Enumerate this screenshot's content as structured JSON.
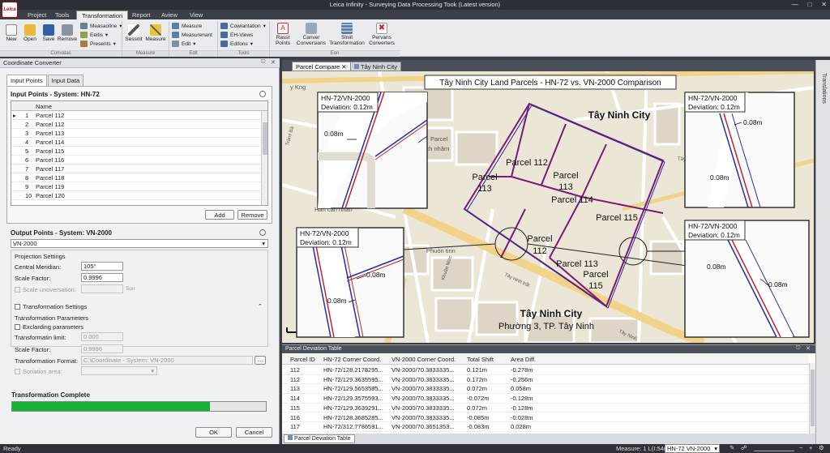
{
  "app": {
    "title": "Leica Infinity - Surveying Data Processing Took (Latest version)",
    "logo": "Leica"
  },
  "menu": [
    "Project",
    "Tools",
    "Transformation",
    "Report",
    "Aview",
    "View"
  ],
  "ribbon": {
    "buttons": [
      "New",
      "Open",
      "Save",
      "Remove",
      "Sessnit",
      "Measure",
      "Rasst\nPoints",
      "Canver\nConversions",
      "Slniit\nTransformation",
      "Pervans\nConverters"
    ],
    "small": [
      "Measaoline",
      "Eeitis",
      "Presents",
      "Measure",
      "Measurenant",
      "Edit",
      "Cowiantation",
      "EH-Views",
      "Edifons"
    ],
    "groups": [
      "Convatas",
      "Measure",
      "Edit",
      "Tools",
      "Eon"
    ]
  },
  "left": {
    "panel_title": "Coordinate Converter",
    "tabs": [
      "Input Points",
      "Input Data"
    ],
    "input_title": "Input Points - System: HN-72",
    "col_name": "Name",
    "rows": [
      {
        "n": "1",
        "name": "Parcel 112"
      },
      {
        "n": "2",
        "name": "Parcel 112"
      },
      {
        "n": "3",
        "name": "Parcel 113"
      },
      {
        "n": "4",
        "name": "Parcel 114"
      },
      {
        "n": "5",
        "name": "Parcel 115"
      },
      {
        "n": "6",
        "name": "Parcel 116"
      },
      {
        "n": "7",
        "name": "Parcel 117"
      },
      {
        "n": "8",
        "name": "Parcel 118"
      },
      {
        "n": "9",
        "name": "Parcel 119"
      },
      {
        "n": "10",
        "name": "Parcel 120"
      }
    ],
    "add": "Add",
    "remove": "Remove",
    "output_title": "Output Points - System: VN-2000",
    "output_system": "VN-2000",
    "proj_settings": "Projection Settings",
    "cm_label": "Central Meridian:",
    "cm_value": "105°",
    "sf_label": "Scale Factor:",
    "sf_value": "0.9996",
    "su_label": "Scale unoversation:",
    "su_value": "",
    "su_unit": "Son",
    "trans_settings": "Transformation Settings",
    "trans_params": "Transformation Parameters",
    "excl_label": "Exclarding parameters",
    "tlimit_label": "Transformatin limit:",
    "tlimit_value": "0.000",
    "sf2_label": "Scale Factor:",
    "sf2_value": "0.9996",
    "tformat_label": "Transformation Format:",
    "tformat_value": "C:\\Coordinate - System: VN-2000",
    "sor_label": "Soriation area:",
    "complete": "Transformation Complete",
    "progress": 0.78,
    "ok": "OK",
    "cancel": "Cancel"
  },
  "doc_tabs": [
    "Parcel Compare",
    "Tây Ninh City"
  ],
  "map": {
    "title": "Tây Ninh City Land Parcels - HN-72 vs. VN-2000 Comparison",
    "city_label": "Tây Ninh City",
    "bottom_city": "Tây Ninh City",
    "ward": "Phường 3, TP. Tây Ninh",
    "parcels": [
      {
        "l1": "Parcel 112",
        "l2": ""
      },
      {
        "l1": "Parcel",
        "l2": "113"
      },
      {
        "l1": "Parcel",
        "l2": "113"
      },
      {
        "l1": "Parcel 114",
        "l2": ""
      },
      {
        "l1": "Parcel 115",
        "l2": ""
      },
      {
        "l1": "Parcel",
        "l2": "112"
      },
      {
        "l1": "Parcel 113",
        "l2": ""
      },
      {
        "l1": "Parcel",
        "l2": "115"
      }
    ],
    "streets": [
      "y Kng",
      "Parcel",
      "rch nhâm",
      "Hàn cán nhàn",
      "Phuòn tirin",
      "Tây ninh trất",
      "Tây Ninh",
      "Trảml Bà",
      "Khuân Mức",
      "Tây"
    ],
    "inset_header": "HN-72/VN-2000",
    "inset_dev": "Deviation: 0.12m",
    "inset_val": "0.08m"
  },
  "right_strip": "Translations",
  "table": {
    "title": "Parcel Deviation Table",
    "headers": [
      "Parcel ID",
      "HN-72 Corner Coord.",
      "VN-2000 Corner Coord.",
      "Total Shift",
      "Area Diff."
    ],
    "rows": [
      [
        "112",
        "HN-72/128.2178295...",
        "VN-2000/70.3833335...",
        "0.121m",
        "-0.278m"
      ],
      [
        "112",
        "HN-72/129.3635595...",
        "VN-2000/70.3833335...",
        "0.172m",
        "-0.256m"
      ],
      [
        "113",
        "HN-72/129.5653585...",
        "VN-2000/70.3833335...",
        "0.072m",
        "0.058m"
      ],
      [
        "114",
        "HN-72/129.3575593...",
        "VN-2000/70.3833335...",
        "-0.072m",
        "-0.128m"
      ],
      [
        "115",
        "HN-72/129.3639291...",
        "VN-2000/70.3833335...",
        "0.072m",
        "-0.128m"
      ],
      [
        "116",
        "HN-72/128.3685285...",
        "VN-2000/70.3833335...",
        "-0.085m",
        "-0.028m"
      ],
      [
        "117",
        "HN-72/312.7786591...",
        "VN-2000/70.3651353...",
        "-0.083m",
        "0.028m"
      ]
    ],
    "bottom_tab": "Parcel Deviation Table"
  },
  "status": {
    "left": "Ready",
    "measure": "Measure: 1 L(I:54(t)",
    "system": "HN-72 VN-2000"
  },
  "colors": {
    "hn72": "#c0262e",
    "vn2000": "#2a2ea0",
    "parcel": "#6a1a6a",
    "progress": "#16b132"
  }
}
